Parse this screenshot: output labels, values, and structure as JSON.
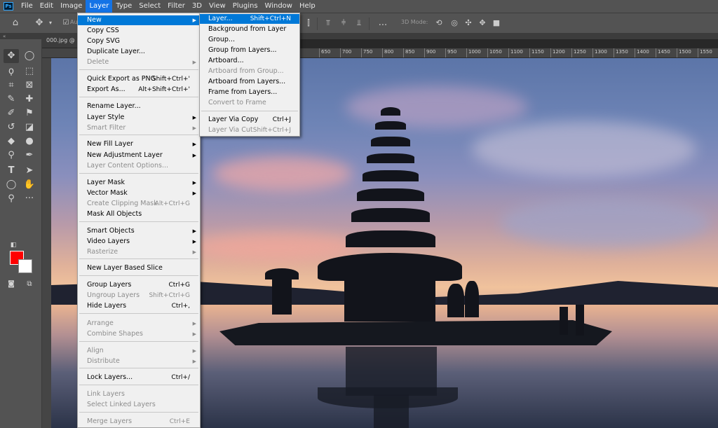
{
  "app": {
    "logo_text": "Ps"
  },
  "menubar": [
    "File",
    "Edit",
    "Image",
    "Layer",
    "Type",
    "Select",
    "Filter",
    "3D",
    "View",
    "Plugins",
    "Window",
    "Help"
  ],
  "options": {
    "auto_label": "Au",
    "mode_3d": "3D Mode:",
    "more": "..."
  },
  "document": {
    "tab": "000.jpg @",
    "ruler_ticks": [
      "650",
      "700",
      "750",
      "800",
      "850",
      "900",
      "950",
      "1000",
      "1050",
      "1100",
      "1150",
      "1200",
      "1250",
      "1300",
      "1350",
      "1400",
      "1450",
      "1500",
      "1550"
    ]
  },
  "layer_menu": [
    {
      "label": "New",
      "shortcut": "",
      "sub": true,
      "disabled": false,
      "highlighted": true
    },
    {
      "label": "Copy CSS",
      "shortcut": "",
      "sub": false,
      "disabled": false
    },
    {
      "label": "Copy SVG",
      "shortcut": "",
      "sub": false,
      "disabled": false
    },
    {
      "label": "Duplicate Layer...",
      "shortcut": "",
      "sub": false,
      "disabled": false
    },
    {
      "label": "Delete",
      "shortcut": "",
      "sub": true,
      "disabled": true
    },
    {
      "label": "Quick Export as PNG",
      "shortcut": "Shift+Ctrl+'",
      "sub": false,
      "disabled": false
    },
    {
      "label": "Export As...",
      "shortcut": "Alt+Shift+Ctrl+'",
      "sub": false,
      "disabled": false
    },
    {
      "label": "Rename Layer...",
      "shortcut": "",
      "sub": false,
      "disabled": false
    },
    {
      "label": "Layer Style",
      "shortcut": "",
      "sub": true,
      "disabled": false
    },
    {
      "label": "Smart Filter",
      "shortcut": "",
      "sub": true,
      "disabled": true
    },
    {
      "label": "New Fill Layer",
      "shortcut": "",
      "sub": true,
      "disabled": false
    },
    {
      "label": "New Adjustment Layer",
      "shortcut": "",
      "sub": true,
      "disabled": false
    },
    {
      "label": "Layer Content Options...",
      "shortcut": "",
      "sub": false,
      "disabled": true
    },
    {
      "label": "Layer Mask",
      "shortcut": "",
      "sub": true,
      "disabled": false
    },
    {
      "label": "Vector Mask",
      "shortcut": "",
      "sub": true,
      "disabled": false
    },
    {
      "label": "Create Clipping Mask",
      "shortcut": "Alt+Ctrl+G",
      "sub": false,
      "disabled": true
    },
    {
      "label": "Mask All Objects",
      "shortcut": "",
      "sub": false,
      "disabled": false
    },
    {
      "label": "Smart Objects",
      "shortcut": "",
      "sub": true,
      "disabled": false
    },
    {
      "label": "Video Layers",
      "shortcut": "",
      "sub": true,
      "disabled": false
    },
    {
      "label": "Rasterize",
      "shortcut": "",
      "sub": true,
      "disabled": true
    },
    {
      "label": "New Layer Based Slice",
      "shortcut": "",
      "sub": false,
      "disabled": false
    },
    {
      "label": "Group Layers",
      "shortcut": "Ctrl+G",
      "sub": false,
      "disabled": false
    },
    {
      "label": "Ungroup Layers",
      "shortcut": "Shift+Ctrl+G",
      "sub": false,
      "disabled": true
    },
    {
      "label": "Hide Layers",
      "shortcut": "Ctrl+,",
      "sub": false,
      "disabled": false
    },
    {
      "label": "Arrange",
      "shortcut": "",
      "sub": true,
      "disabled": true
    },
    {
      "label": "Combine Shapes",
      "shortcut": "",
      "sub": true,
      "disabled": true
    },
    {
      "label": "Align",
      "shortcut": "",
      "sub": true,
      "disabled": true
    },
    {
      "label": "Distribute",
      "shortcut": "",
      "sub": true,
      "disabled": true
    },
    {
      "label": "Lock Layers...",
      "shortcut": "Ctrl+/",
      "sub": false,
      "disabled": false
    },
    {
      "label": "Link Layers",
      "shortcut": "",
      "sub": false,
      "disabled": true
    },
    {
      "label": "Select Linked Layers",
      "shortcut": "",
      "sub": false,
      "disabled": true
    },
    {
      "label": "Merge Layers",
      "shortcut": "Ctrl+E",
      "sub": false,
      "disabled": true
    }
  ],
  "new_submenu": [
    {
      "label": "Layer...",
      "shortcut": "Shift+Ctrl+N",
      "disabled": false,
      "highlighted": true
    },
    {
      "label": "Background from Layer",
      "shortcut": "",
      "disabled": false
    },
    {
      "label": "Group...",
      "shortcut": "",
      "disabled": false
    },
    {
      "label": "Group from Layers...",
      "shortcut": "",
      "disabled": false
    },
    {
      "label": "Artboard...",
      "shortcut": "",
      "disabled": false
    },
    {
      "label": "Artboard from Group...",
      "shortcut": "",
      "disabled": true
    },
    {
      "label": "Artboard from Layers...",
      "shortcut": "",
      "disabled": false
    },
    {
      "label": "Frame from Layers...",
      "shortcut": "",
      "disabled": false
    },
    {
      "label": "Convert to Frame",
      "shortcut": "",
      "disabled": true
    },
    {
      "label": "Layer Via Copy",
      "shortcut": "Ctrl+J",
      "disabled": false
    },
    {
      "label": "Layer Via Cut",
      "shortcut": "Shift+Ctrl+J",
      "disabled": true
    }
  ],
  "colors": {
    "foreground": "#ff0000",
    "background": "#ffffff",
    "accent": "#1473e6"
  }
}
